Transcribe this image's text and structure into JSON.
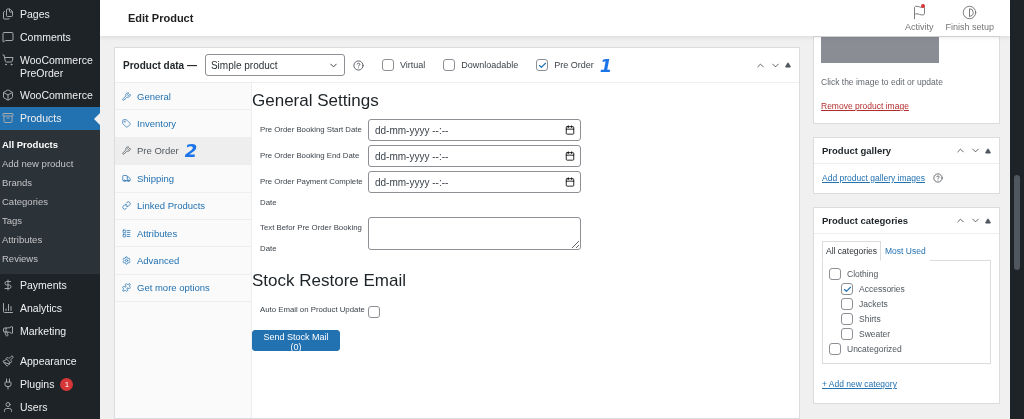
{
  "sidebar": {
    "items": [
      {
        "label": "Pages",
        "selected": false
      },
      {
        "label": "Comments",
        "selected": false
      },
      {
        "label": "WooCommerce PreOrder",
        "selected": false
      },
      {
        "label": "WooCommerce",
        "selected": false
      },
      {
        "label": "Products",
        "selected": true,
        "children": [
          {
            "label": "All Products",
            "selected": true
          },
          {
            "label": "Add new product",
            "selected": false
          },
          {
            "label": "Brands",
            "selected": false
          },
          {
            "label": "Categories",
            "selected": false
          },
          {
            "label": "Tags",
            "selected": false
          },
          {
            "label": "Attributes",
            "selected": false
          },
          {
            "label": "Reviews",
            "selected": false
          }
        ]
      },
      {
        "label": "Payments",
        "selected": false
      },
      {
        "label": "Analytics",
        "selected": false
      },
      {
        "label": "Marketing",
        "selected": false
      },
      {
        "label": "Appearance",
        "selected": false
      },
      {
        "label": "Plugins",
        "selected": false,
        "badge": "1"
      },
      {
        "label": "Users",
        "selected": false
      }
    ]
  },
  "header": {
    "title": "Edit Product",
    "actions": [
      {
        "label": "Activity",
        "unread": true
      },
      {
        "label": "Finish setup",
        "unread": false
      }
    ]
  },
  "product_data": {
    "title": "Product data —",
    "product_type": "Simple product",
    "options": [
      {
        "label": "Virtual",
        "checked": false
      },
      {
        "label": "Downloadable",
        "checked": false
      },
      {
        "label": "Pre Order",
        "checked": true,
        "annotation": "1"
      }
    ],
    "tabs": [
      {
        "label": "General",
        "selected": false
      },
      {
        "label": "Inventory",
        "selected": false
      },
      {
        "label": "Pre Order",
        "selected": true,
        "annotation": "2"
      },
      {
        "label": "Shipping",
        "selected": false
      },
      {
        "label": "Linked Products",
        "selected": false
      },
      {
        "label": "Attributes",
        "selected": false
      },
      {
        "label": "Advanced",
        "selected": false
      },
      {
        "label": "Get more options",
        "selected": false
      }
    ],
    "sections": [
      {
        "title": "General Settings",
        "fields": [
          {
            "kind": "datetime",
            "label": "Pre Order Booking Start Date",
            "placeholder": "dd-mm-yyyy --:--"
          },
          {
            "kind": "datetime",
            "label": "Pre Order Booking End Date",
            "placeholder": "dd-mm-yyyy --:--"
          },
          {
            "kind": "datetime",
            "label": "Pre Order Payment Complete Date",
            "placeholder": "dd-mm-yyyy --:--"
          },
          {
            "kind": "textarea",
            "label": "Text Befor Pre Order Booking Date"
          }
        ]
      },
      {
        "title": "Stock Restore Email",
        "fields": [
          {
            "kind": "checkbox",
            "label": "Auto Email on Product Update",
            "checked": false
          }
        ],
        "button": "Send Stock Mail (0)"
      }
    ]
  },
  "product_image": {
    "caption": "Click the image to edit or update",
    "remove_link": "Remove product image"
  },
  "product_gallery": {
    "title": "Product gallery",
    "link": "Add product gallery images"
  },
  "product_categories": {
    "title": "Product categories",
    "tabs": [
      {
        "label": "All categories",
        "selected": true
      },
      {
        "label": "Most Used",
        "selected": false
      }
    ],
    "items": [
      {
        "label": "Clothing",
        "checked": false,
        "children": [
          {
            "label": "Accessories",
            "checked": true
          },
          {
            "label": "Jackets",
            "checked": false
          },
          {
            "label": "Shirts",
            "checked": false
          },
          {
            "label": "Sweater",
            "checked": false
          }
        ]
      },
      {
        "label": "Uncategorized",
        "checked": false
      }
    ],
    "add_link": "+ Add new category"
  }
}
